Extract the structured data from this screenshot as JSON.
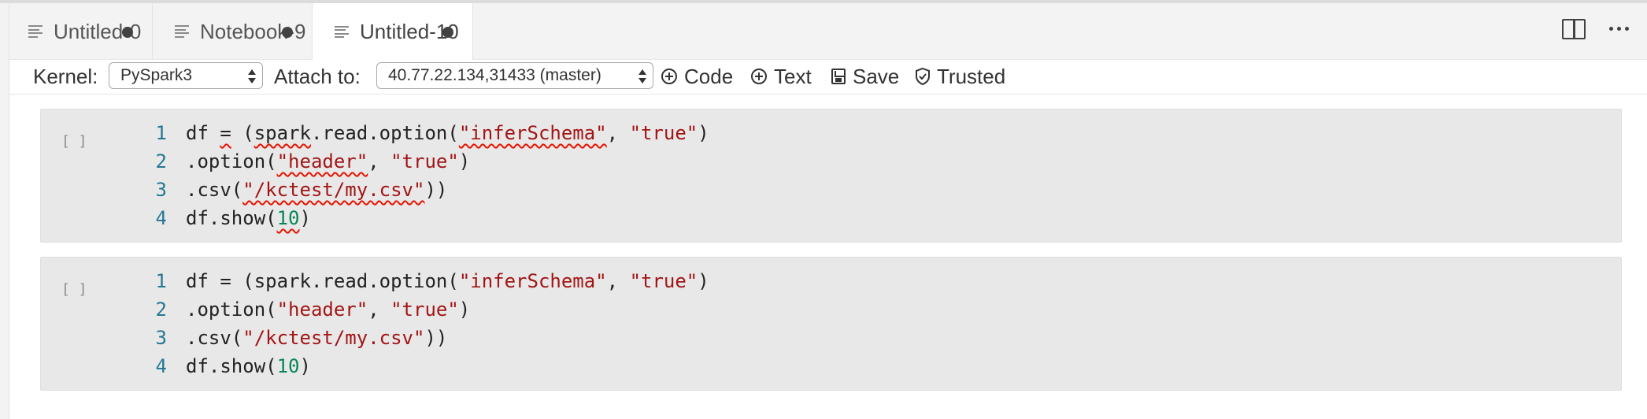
{
  "tabs": [
    {
      "label": "Untitled-0",
      "icon": "file-lines-icon",
      "dirty": true,
      "active": false
    },
    {
      "label": "Notebook-9",
      "icon": "file-lines-icon",
      "dirty": true,
      "active": false
    },
    {
      "label": "Untitled-10",
      "icon": "file-lines-icon",
      "dirty": true,
      "active": true
    }
  ],
  "editor_actions": {
    "split_icon": "split-editor-icon",
    "more_icon": "more-actions-icon"
  },
  "toolbar": {
    "kernel_label": "Kernel:",
    "kernel_value": "PySpark3",
    "attach_label": "Attach to:",
    "attach_value": "40.77.22.134,31433 (master)",
    "code_label": "Code",
    "text_label": "Text",
    "save_label": "Save",
    "trusted_label": "Trusted"
  },
  "cells": [
    {
      "execution_count": "[ ]",
      "has_lint_errors": true,
      "lines": [
        {
          "num": "1"
        },
        {
          "num": "2"
        },
        {
          "num": "3"
        },
        {
          "num": "4"
        }
      ]
    },
    {
      "execution_count": "[ ]",
      "has_lint_errors": false,
      "lines": [
        {
          "num": "1"
        },
        {
          "num": "2"
        },
        {
          "num": "3"
        },
        {
          "num": "4"
        }
      ]
    }
  ],
  "code_tokens": {
    "l1_a": "df ",
    "l1_eq": "=",
    "l1_b": " (",
    "l1_spark": "spark",
    "l1_c": ".read.option(",
    "l1_s1": "\"inferSchema\"",
    "l1_d": ", ",
    "l1_s2": "\"true\"",
    "l1_e": ")",
    "l2_a": ".option(",
    "l2_s1": "\"header\"",
    "l2_b": ", ",
    "l2_s2": "\"true\"",
    "l2_c": ")",
    "l3_a": ".csv(",
    "l3_s1": "\"/kctest/my.csv\"",
    "l3_b": "))",
    "l4_a": "df.show(",
    "l4_n": "10",
    "l4_b": ")"
  },
  "colors": {
    "string": "#a31515",
    "number": "#098658",
    "line_number": "#237893",
    "error_squiggle": "#e51400",
    "cell_bg": "#e8e8e8"
  }
}
